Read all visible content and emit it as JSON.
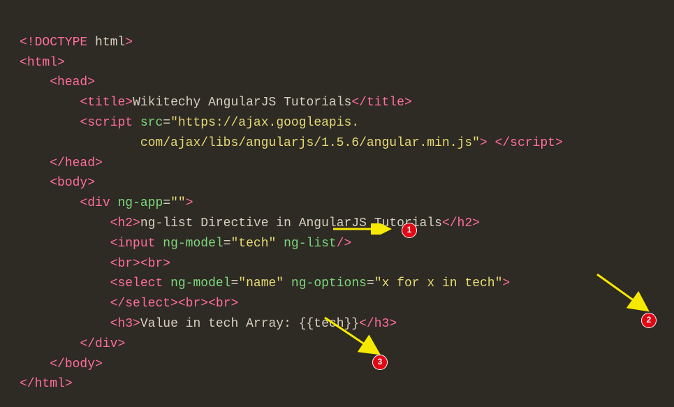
{
  "code": {
    "l1": {
      "doctype_open": "<!DOCTYPE",
      "doctype_name": " html",
      "doctype_close": ">"
    },
    "l2": {
      "open": "<",
      "tag": "html",
      "close": ">"
    },
    "l3": {
      "open": "<",
      "tag": "head",
      "close": ">"
    },
    "l4": {
      "open": "<",
      "tag": "title",
      "close": ">",
      "text": "Wikitechy AngularJS Tutorials",
      "end_open": "</",
      "end_tag": "title",
      "end_close": ">"
    },
    "l5a": {
      "open": "<",
      "tag": "script",
      "sp": " ",
      "attr": "src",
      "eq": "=",
      "q": "\"",
      "url_part1": "https://ajax.googleapis."
    },
    "l5b": {
      "url_part2": "com/ajax/libs/angularjs/1.5.6/angular.min.js",
      "q": "\"",
      "close": ">",
      "sp": " ",
      "end_open": "</",
      "end_tag": "script",
      "end_close": ">"
    },
    "l6": {
      "open": "</",
      "tag": "head",
      "close": ">"
    },
    "l7": {
      "open": "<",
      "tag": "body",
      "close": ">"
    },
    "l8": {
      "open": "<",
      "tag": "div",
      "sp": " ",
      "attr": "ng-app",
      "eq": "=",
      "val": "\"\"",
      "close": ">"
    },
    "l9": {
      "open": "<",
      "tag": "h2",
      "close": ">",
      "text": "ng-list Directive in AngularJS Tutorials",
      "end_open": "</",
      "end_tag": "h2",
      "end_close": ">"
    },
    "l10": {
      "open": "<",
      "tag": "input",
      "sp1": " ",
      "attr1": "ng-model",
      "eq1": "=",
      "val1": "\"tech\"",
      "sp2": " ",
      "attr2": "ng-list",
      "close": "/>"
    },
    "l11": {
      "br1_open": "<",
      "br1": "br",
      "br1_close": ">",
      "br2_open": "<",
      "br2": "br",
      "br2_close": ">"
    },
    "l12": {
      "open": "<",
      "tag": "select",
      "sp1": " ",
      "attr1": "ng-model",
      "eq1": "=",
      "val1": "\"name\"",
      "sp2": " ",
      "attr2": "ng-options",
      "eq2": "=",
      "val2": "\"x for x in tech\"",
      "close": ">"
    },
    "l13": {
      "end_open": "</",
      "end_tag": "select",
      "end_close": ">",
      "br1_open": "<",
      "br1": "br",
      "br1_close": ">",
      "br2_open": "<",
      "br2": "br",
      "br2_close": ">"
    },
    "l14": {
      "open": "<",
      "tag": "h3",
      "close": ">",
      "text": "Value in tech Array: {{tech}}",
      "end_open": "</",
      "end_tag": "h3",
      "end_close": ">"
    },
    "l15": {
      "open": "</",
      "tag": "div",
      "close": ">"
    },
    "l16": {
      "open": "</",
      "tag": "body",
      "close": ">"
    },
    "l17": {
      "open": "</",
      "tag": "html",
      "close": ">"
    }
  },
  "badges": {
    "b1": "1",
    "b2": "2",
    "b3": "3"
  }
}
